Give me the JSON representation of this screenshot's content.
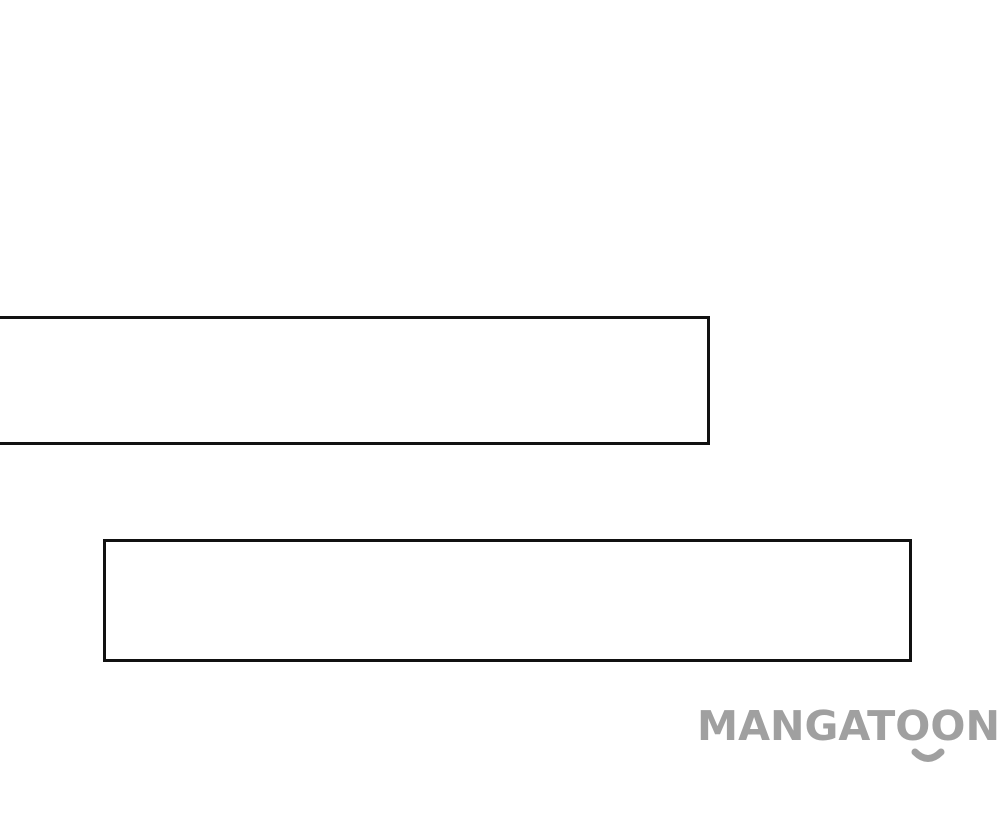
{
  "page": {
    "background_color": "#ffffff"
  },
  "panels": [
    {
      "name": "speech-box-upper",
      "text": ""
    },
    {
      "name": "speech-box-lower",
      "text": ""
    }
  ],
  "watermark": {
    "text": "MANGATOON",
    "color": "#a0a0a0"
  }
}
